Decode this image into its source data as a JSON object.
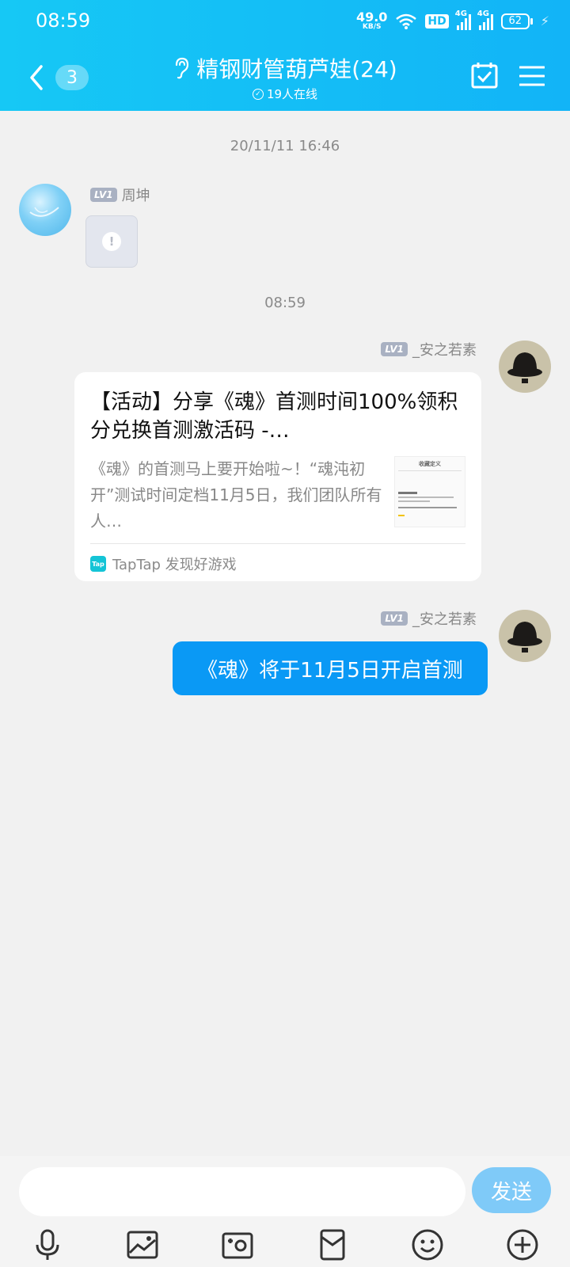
{
  "status": {
    "time": "08:59",
    "net_speed": "49.0",
    "net_unit": "KB/S",
    "hd": "HD",
    "sig1": "4G",
    "sig2": "4G",
    "battery": "62"
  },
  "header": {
    "badge_count": "3",
    "title": "精钢财管葫芦娃(24)",
    "online": "19人在线",
    "accent": "#12b4f7"
  },
  "chat": {
    "timestamp1": "20/11/11 16:46",
    "msg1": {
      "level": "LV1",
      "sender": "周坤"
    },
    "timestamp2": "08:59",
    "msg2": {
      "level": "LV1",
      "sender": "_安之若素",
      "card_title": "【活动】分享《魂》首测时间100%领积分兑换首测激活码 -…",
      "card_desc": "《魂》的首测马上要开始啦~！“魂沌初开”测试时间定档11月5日，我们团队所有人…",
      "thumb_title": "收藏定义",
      "source": "TapTap 发现好游戏"
    },
    "msg3": {
      "level": "LV1",
      "sender": "_安之若素",
      "text": "《魂》将于11月5日开启首测"
    }
  },
  "composer": {
    "send_label": "发送",
    "placeholder": ""
  }
}
